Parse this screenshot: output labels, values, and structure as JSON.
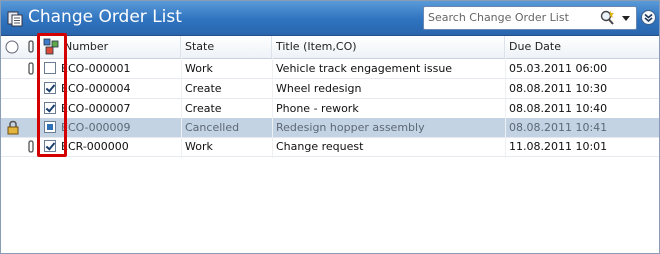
{
  "window": {
    "title": "Change Order List"
  },
  "search": {
    "placeholder": "Search Change Order List"
  },
  "columns": {
    "number": "Number",
    "state": "State",
    "title": "Title (Item,CO)",
    "due": "Due Date"
  },
  "rows": [
    {
      "number": "ECO-000001",
      "state": "Work",
      "title": "Vehicle track engagement issue",
      "due": "05.03.2011 06:00",
      "checked": false,
      "attachment": true,
      "locked": false,
      "selected": false
    },
    {
      "number": "ECO-000004",
      "state": "Create",
      "title": "Wheel redesign",
      "due": "08.08.2011 10:30",
      "checked": true,
      "attachment": false,
      "locked": false,
      "selected": false
    },
    {
      "number": "ECO-000007",
      "state": "Create",
      "title": "Phone - rework",
      "due": "08.08.2011 10:40",
      "checked": true,
      "attachment": false,
      "locked": false,
      "selected": false
    },
    {
      "number": "ECO-000009",
      "state": "Cancelled",
      "title": "Redesign hopper assembly",
      "due": "08.08.2011 10:41",
      "checked": "indeterminate",
      "attachment": false,
      "locked": true,
      "selected": true
    },
    {
      "number": "ECR-000000",
      "state": "Work",
      "title": "Change request",
      "due": "11.08.2011 10:01",
      "checked": true,
      "attachment": true,
      "locked": false,
      "selected": false
    }
  ],
  "icons": {
    "app": "list-window-icon",
    "search": "search-magnifier-icon",
    "dropdown": "chevron-down-icon",
    "collapse": "double-chevron-down-icon",
    "select_all": "radio-icon",
    "attachment": "paperclip-icon",
    "workflow": "workflow-icon",
    "lock": "lock-icon"
  },
  "colors": {
    "titlebar": "#2f73bf",
    "selected_row": "#c4d3e3",
    "highlight": "#d40000"
  }
}
